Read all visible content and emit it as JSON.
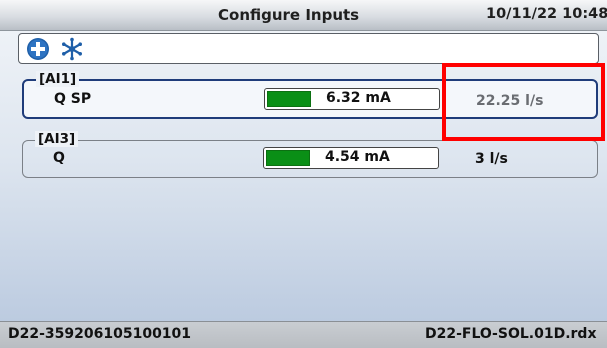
{
  "header": {
    "title": "Configure Inputs",
    "datetime": "10/11/22 10:48"
  },
  "toolbar": {
    "add_icon": "plus-circle-icon",
    "network_icon": "asterisk-network-icon",
    "icon_color": "#1f5fa8"
  },
  "inputs": [
    {
      "channel": "[AI1]",
      "name": "Q SP",
      "current": "6.32 mA",
      "current_fraction": 0.26,
      "value": "22.25 l/s",
      "selected": true
    },
    {
      "channel": "[AI3]",
      "name": "Q",
      "current": "4.54 mA",
      "current_fraction": 0.26,
      "value": "3 l/s",
      "selected": false
    }
  ],
  "status": {
    "serial": "D22-359206105100101",
    "file": "D22-FLO-SOL.01D.rdx"
  },
  "colors": {
    "bar_fill": "#0a8f16",
    "highlight": "#ff0000",
    "selection_border": "#1f3c7a"
  }
}
